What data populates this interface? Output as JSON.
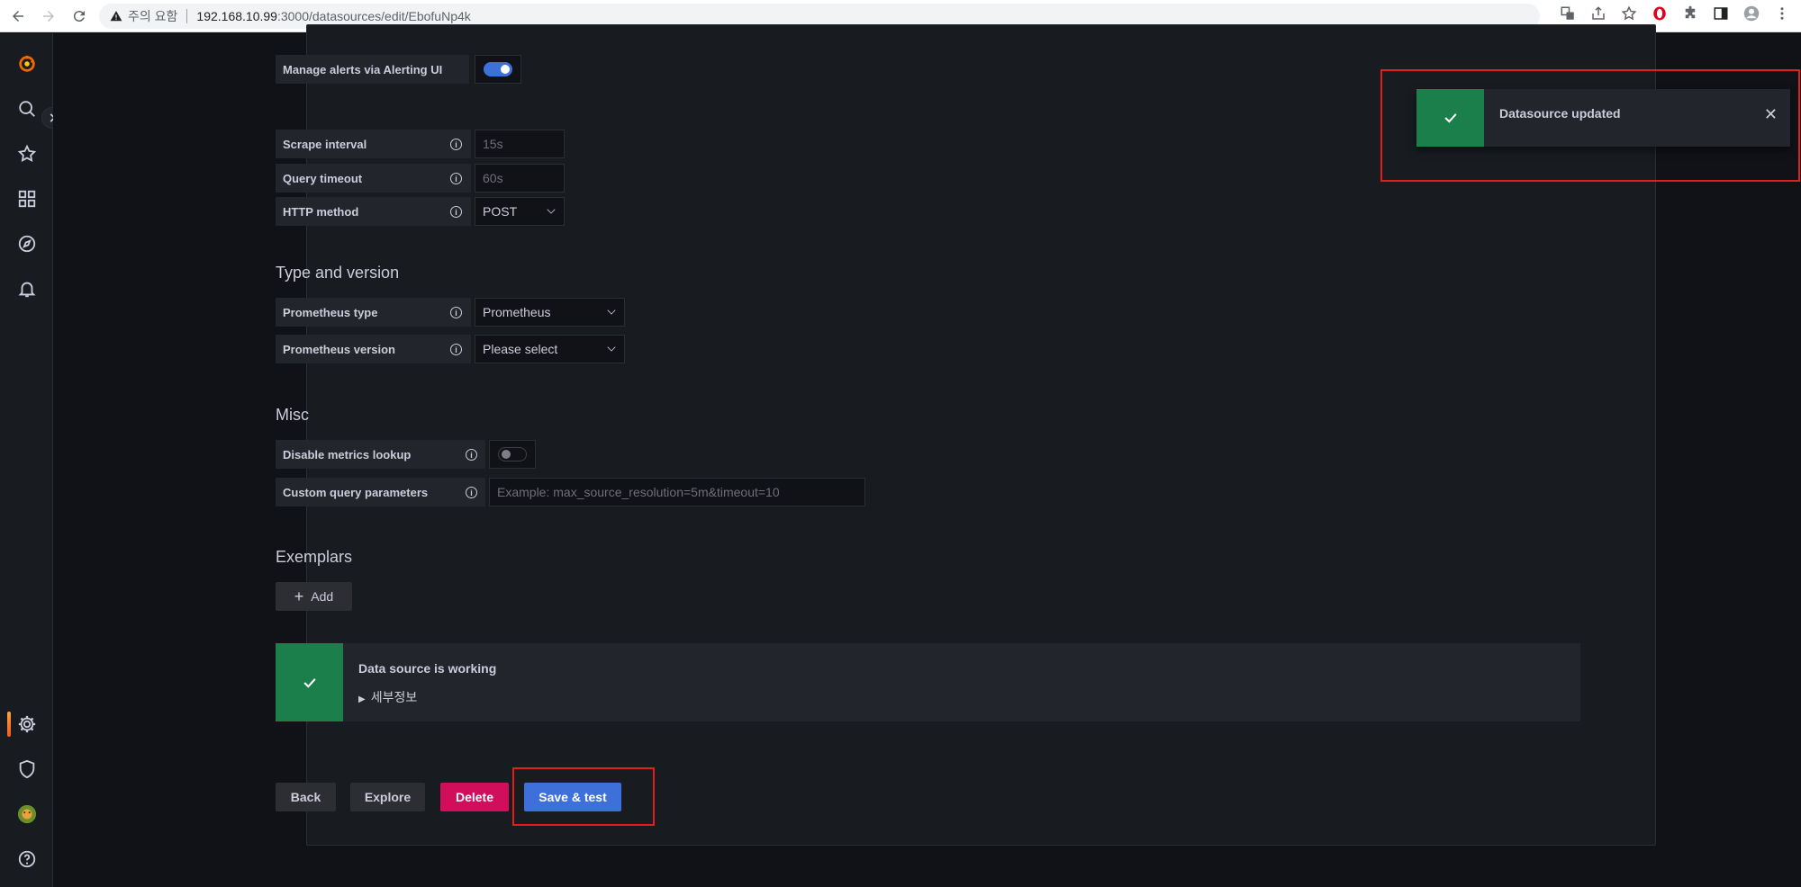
{
  "browser": {
    "warning": "주의 요함",
    "url_host": "192.168.10.99",
    "url_rest": ":3000/datasources/edit/EbofuNp4k"
  },
  "alerting": {
    "manage_label": "Manage alerts via Alerting UI",
    "manage_enabled": true
  },
  "http": {
    "scrape_label": "Scrape interval",
    "scrape_placeholder": "15s",
    "timeout_label": "Query timeout",
    "timeout_placeholder": "60s",
    "method_label": "HTTP method",
    "method_value": "POST"
  },
  "type_version": {
    "title": "Type and version",
    "type_label": "Prometheus type",
    "type_value": "Prometheus",
    "version_label": "Prometheus version",
    "version_value": "Please select"
  },
  "misc": {
    "title": "Misc",
    "disable_lookup_label": "Disable metrics lookup",
    "disable_lookup_enabled": false,
    "custom_params_label": "Custom query parameters",
    "custom_params_placeholder": "Example: max_source_resolution=5m&timeout=10"
  },
  "exemplars": {
    "title": "Exemplars",
    "add_label": "Add"
  },
  "status": {
    "title": "Data source is working",
    "details": "세부정보"
  },
  "actions": {
    "back": "Back",
    "explore": "Explore",
    "delete": "Delete",
    "save_test": "Save & test"
  },
  "toast": {
    "message": "Datasource updated"
  },
  "colors": {
    "primary": "#3d71d9",
    "success": "#1a7f4b",
    "danger": "#d10e5c",
    "highlight": "#e02020"
  }
}
